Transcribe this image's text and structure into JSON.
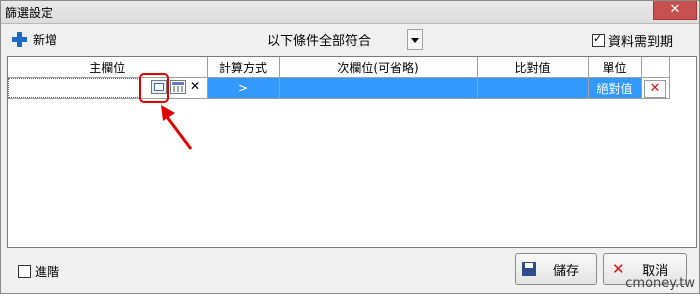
{
  "window": {
    "title": "篩選設定",
    "close_glyph": "✕"
  },
  "toolbar": {
    "new_label": "新增",
    "condition_mode": "以下條件全部符合",
    "required_label": "資料需到期",
    "required_checked": true
  },
  "grid": {
    "headers": [
      "主欄位",
      "計算方式",
      "次欄位(可省略)",
      "比對值",
      "單位",
      ""
    ],
    "row": {
      "main_field": "",
      "operator": ">",
      "secondary_field": "",
      "compare_value": "",
      "unit": "絕對值",
      "delete_glyph": "✕"
    }
  },
  "footer": {
    "advanced_label": "進階",
    "advanced_checked": false,
    "save_label": "儲存",
    "cancel_label": "取消"
  },
  "watermark": "cmoney.tw"
}
